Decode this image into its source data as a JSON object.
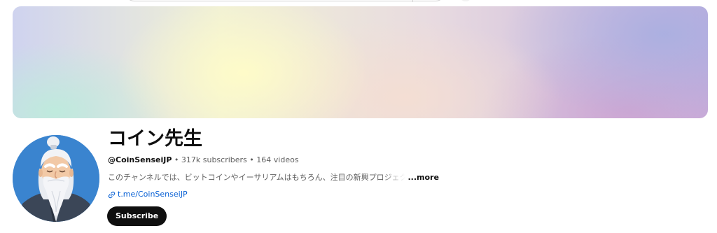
{
  "channel": {
    "name": "コイン先生",
    "handle": "@CoinSenseiJP",
    "separator": " • ",
    "subscribers": "317k subscribers",
    "videos": "164 videos",
    "description": "このチャンネルでは、ビットコインやイーサリアムはもちろん、注目の新興プロジェクトを",
    "more_label": "...more",
    "link_text": "t.me/CoinSenseiJP",
    "subscribe_label": "Subscribe"
  },
  "icons": {
    "avatar": "old-sage-avatar",
    "link": "link-icon"
  },
  "colors": {
    "subscribe_bg": "#0f0f0f",
    "link": "#065fd4",
    "secondary_text": "#606060",
    "avatar_bg": "#3a84cf"
  }
}
